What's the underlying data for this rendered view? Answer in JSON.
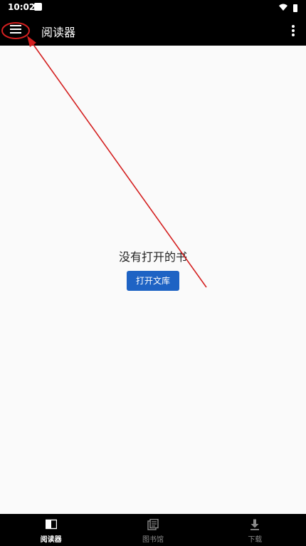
{
  "status_bar": {
    "time": "10:02"
  },
  "app_bar": {
    "title": "阅读器"
  },
  "main": {
    "empty_message": "没有打开的书",
    "open_library_button": "打开文库"
  },
  "bottom_nav": {
    "items": [
      {
        "label": "阅读器",
        "icon": "reader-icon",
        "active": true
      },
      {
        "label": "图书馆",
        "icon": "library-icon",
        "active": false
      },
      {
        "label": "下载",
        "icon": "download-icon",
        "active": false
      }
    ]
  },
  "colors": {
    "bar_bg": "#000000",
    "page_bg": "#fafafa",
    "primary": "#1e63c4",
    "annotation": "#d42020"
  }
}
